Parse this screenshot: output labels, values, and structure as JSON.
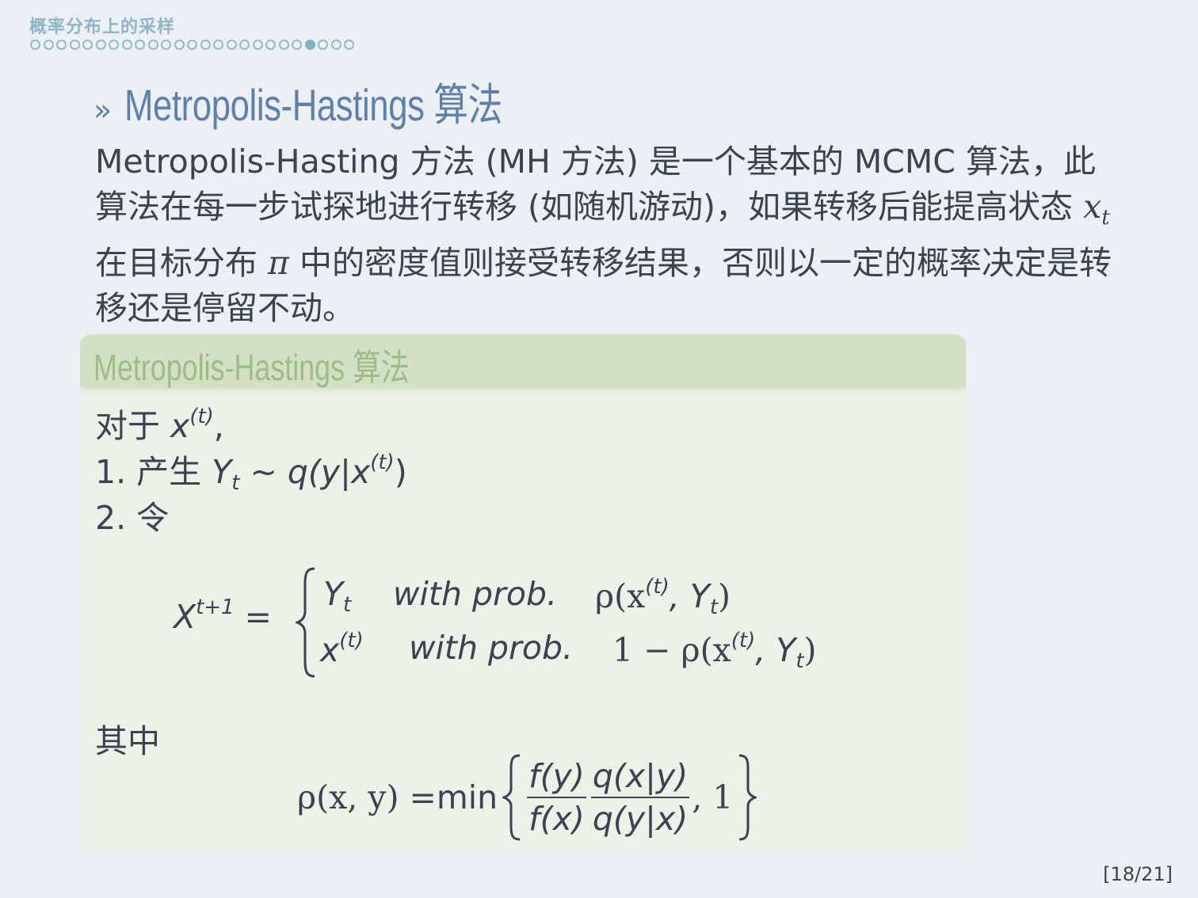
{
  "header": {
    "section_title": "概率分布上的采样",
    "nav_dots_total": 25,
    "nav_dot_active_index": 21
  },
  "frame": {
    "chevron": "»",
    "title": "Metropolis-Hastings 算法"
  },
  "intro": {
    "part1": "Metropolis-Hasting 方法 (MH 方法) 是一个基本的 MCMC 算法，此算法在每一步试探地进行转移 (如随机游动)，如果转移后能提高状态 ",
    "var_x": "x",
    "var_sub": "t",
    "part2": " 在目标分布 ",
    "var_pi": "π",
    "part3": " 中的密度值则接受转移结果，否则以一定的概率决定是转移还是停留不动。"
  },
  "block": {
    "title": "Metropolis-Hastings 算法",
    "line1_text": "对于 ",
    "line1_var": "x",
    "line1_sup": "(t)",
    "line1_end": ",",
    "line2_num": "1. 产生 ",
    "line2_Y": "Y",
    "line2_sub": "t",
    "line2_rest": " ∼ q(y|x",
    "line2_sup": "(t)",
    "line2_end": ")",
    "line3": "2. 令",
    "eq1": {
      "lhs": "X",
      "lhs_sup": "t+1",
      "equals": " =",
      "row1_val": "Y",
      "row1_sub": "t",
      "row1_cond": "with prob.",
      "row1_rho": "ρ(x",
      "row1_sup": "(t)",
      "row1_mid": ", Y",
      "row1_sub2": "t",
      "row1_end": ")",
      "row2_val": "x",
      "row2_sup": "(t)",
      "row2_cond": "with prob.",
      "row2_rho": "1 − ρ(x",
      "row2_sup2": "(t)",
      "row2_mid": ", Y",
      "row2_sub2": "t",
      "row2_end": ")"
    },
    "where": "其中",
    "eq2": {
      "lhs": "ρ(x, y) = ",
      "min": "min",
      "frac1_num": "f(y)",
      "frac1_den": "f(x)",
      "frac2_num": "q(x|y)",
      "frac2_den": "q(y|x)",
      "tail": ", 1"
    }
  },
  "footer": {
    "page": "[18/21]"
  }
}
